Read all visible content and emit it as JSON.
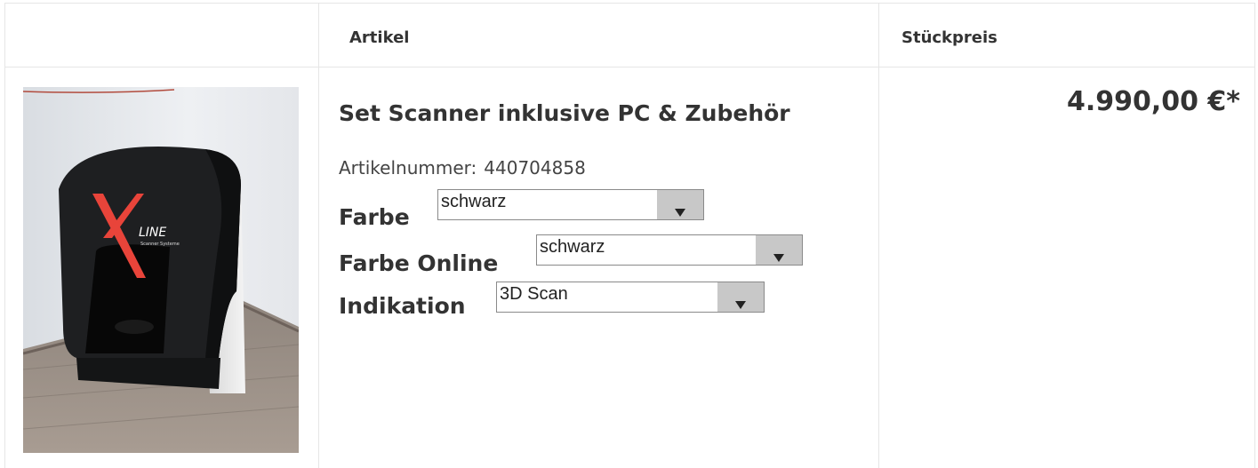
{
  "headers": {
    "article": "Artikel",
    "unit_price": "Stückpreis"
  },
  "product": {
    "image_alt": "Scanner",
    "logo_mark": "X",
    "logo_line": "LINE",
    "logo_sub": "Scanner Systeme",
    "title": "Set Scanner inklusive PC & Zubehör",
    "article_number_label": "Artikelnummer:",
    "article_number": "440704858",
    "price": "4.990,00 €*"
  },
  "options": [
    {
      "label": "Farbe",
      "selected": "schwarz"
    },
    {
      "label": "Farbe Online",
      "selected": "schwarz"
    },
    {
      "label": "Indikation",
      "selected": "3D Scan"
    }
  ],
  "icons": {
    "dropdown": "triangle-down-icon"
  },
  "colors": {
    "border": "#e6e6e6",
    "text": "#333333",
    "select_button": "#c8c8c8",
    "logo_red": "#e8443a"
  }
}
